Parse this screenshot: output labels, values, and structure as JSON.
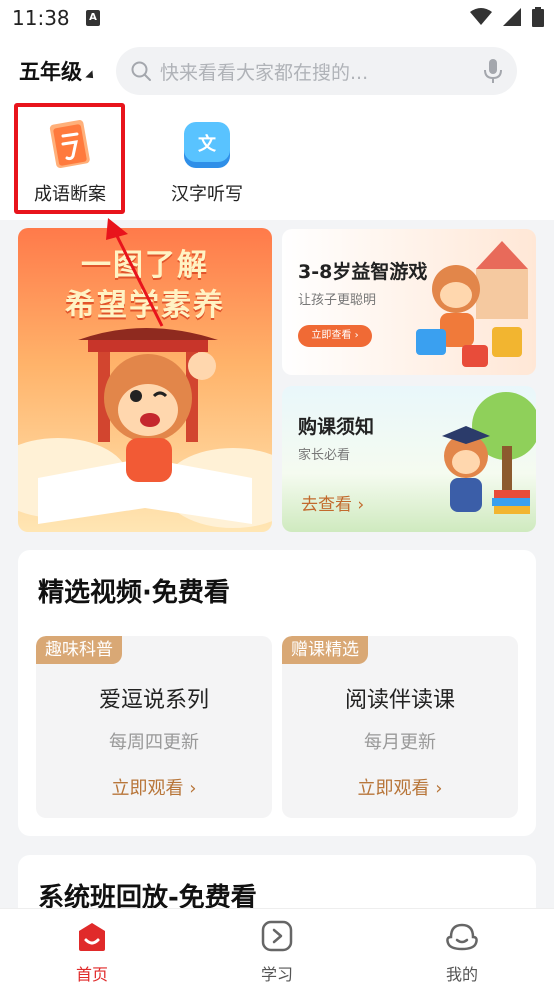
{
  "status_bar": {
    "time": "11:38",
    "notification_glyph": "A"
  },
  "header": {
    "grade": "五年级",
    "search_placeholder": "快来看看大家都在搜的..."
  },
  "shortcuts": [
    {
      "label": "成语断案",
      "icon": "idiom-scroll-icon"
    },
    {
      "label": "汉字听写",
      "icon": "chinese-character-icon"
    }
  ],
  "banner": {
    "line1": "一图了解",
    "line2": "希望学素养"
  },
  "promos": [
    {
      "title": "3-8岁益智游戏",
      "subtitle": "让孩子更聪明",
      "button": "立即查看 ›"
    },
    {
      "title": "购课须知",
      "subtitle": "家长必看",
      "link": "去查看 ›"
    }
  ],
  "video_section": {
    "title": "精选视频·免费看",
    "items": [
      {
        "tag": "趣味科普",
        "title": "爱逗说系列",
        "subtitle": "每周四更新",
        "link": "立即观看 ›"
      },
      {
        "tag": "赠课精选",
        "title": "阅读伴读课",
        "subtitle": "每月更新",
        "link": "立即观看 ›"
      }
    ]
  },
  "system_section": {
    "title": "系统班回放-免费看"
  },
  "bottom_nav": [
    {
      "label": "首页",
      "icon": "home-icon",
      "active": true
    },
    {
      "label": "学习",
      "icon": "study-play-icon",
      "active": false
    },
    {
      "label": "我的",
      "icon": "profile-icon",
      "active": false
    }
  ],
  "colors": {
    "accent_red": "#e02a2a",
    "highlight_red": "#e8141c",
    "tag_tan": "#d9a875",
    "link_brown": "#b8763a"
  }
}
